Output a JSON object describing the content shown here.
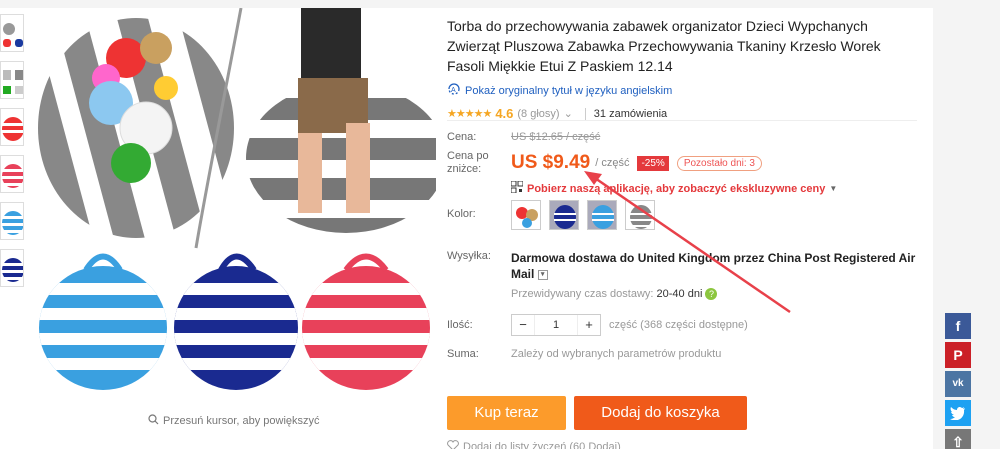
{
  "product": {
    "title": "Torba do przechowywania zabawek organizator Dzieci Wypchanych Zwierząt Pluszowa Zabawka Przechowywania Tkaniny Krzesło Worek Fasoli Miękkie Etui Z Paskiem 12.14",
    "translate_link": "Pokaż oryginalny tytuł w języku angielskim",
    "rating": "4.6",
    "votes": "(8 głosy)",
    "orders": "31 zamówienia",
    "zoom_hint": "Przesuń kursor, aby powiększyć"
  },
  "price": {
    "label_price": "Cena:",
    "old_price": "US $12.65 / część",
    "label_sale": "Cena po zniżce:",
    "new_price": "US $9.49",
    "per_unit": "/ część",
    "discount": "-25%",
    "days_left": "Pozostało dni: 3",
    "app_promo": "Pobierz naszą aplikację, aby zobaczyć ekskluzywne ceny"
  },
  "options": {
    "color_label": "Kolor:",
    "shipping_label": "Wysyłka:",
    "shipping_text": "Darmowa dostawa do United Kingdom przez China Post Registered Air Mail",
    "delivery_label": "Przewidywany czas dostawy:",
    "delivery_value": "20-40 dni",
    "qty_label": "Ilość:",
    "qty_value": "1",
    "qty_note": "część (368 części dostępne)",
    "total_label": "Suma:",
    "total_text": "Zależy od wybranych parametrów produktu"
  },
  "buttons": {
    "buy_now": "Kup teraz",
    "add_to_cart": "Dodaj do koszyka",
    "wishlist": "Dodaj do listy życzeń (60 Dodaj)"
  },
  "colors": {
    "price_orange": "#f05a1a",
    "buy_orange": "#fc9b2b",
    "sale_red": "#e4393c",
    "star": "#f5a623"
  },
  "icons": [
    "facebook-icon",
    "pinterest-icon",
    "vk-icon",
    "twitter-icon",
    "share-icon",
    "search-icon",
    "qr-icon",
    "translate-icon",
    "help-icon",
    "heart-icon"
  ]
}
